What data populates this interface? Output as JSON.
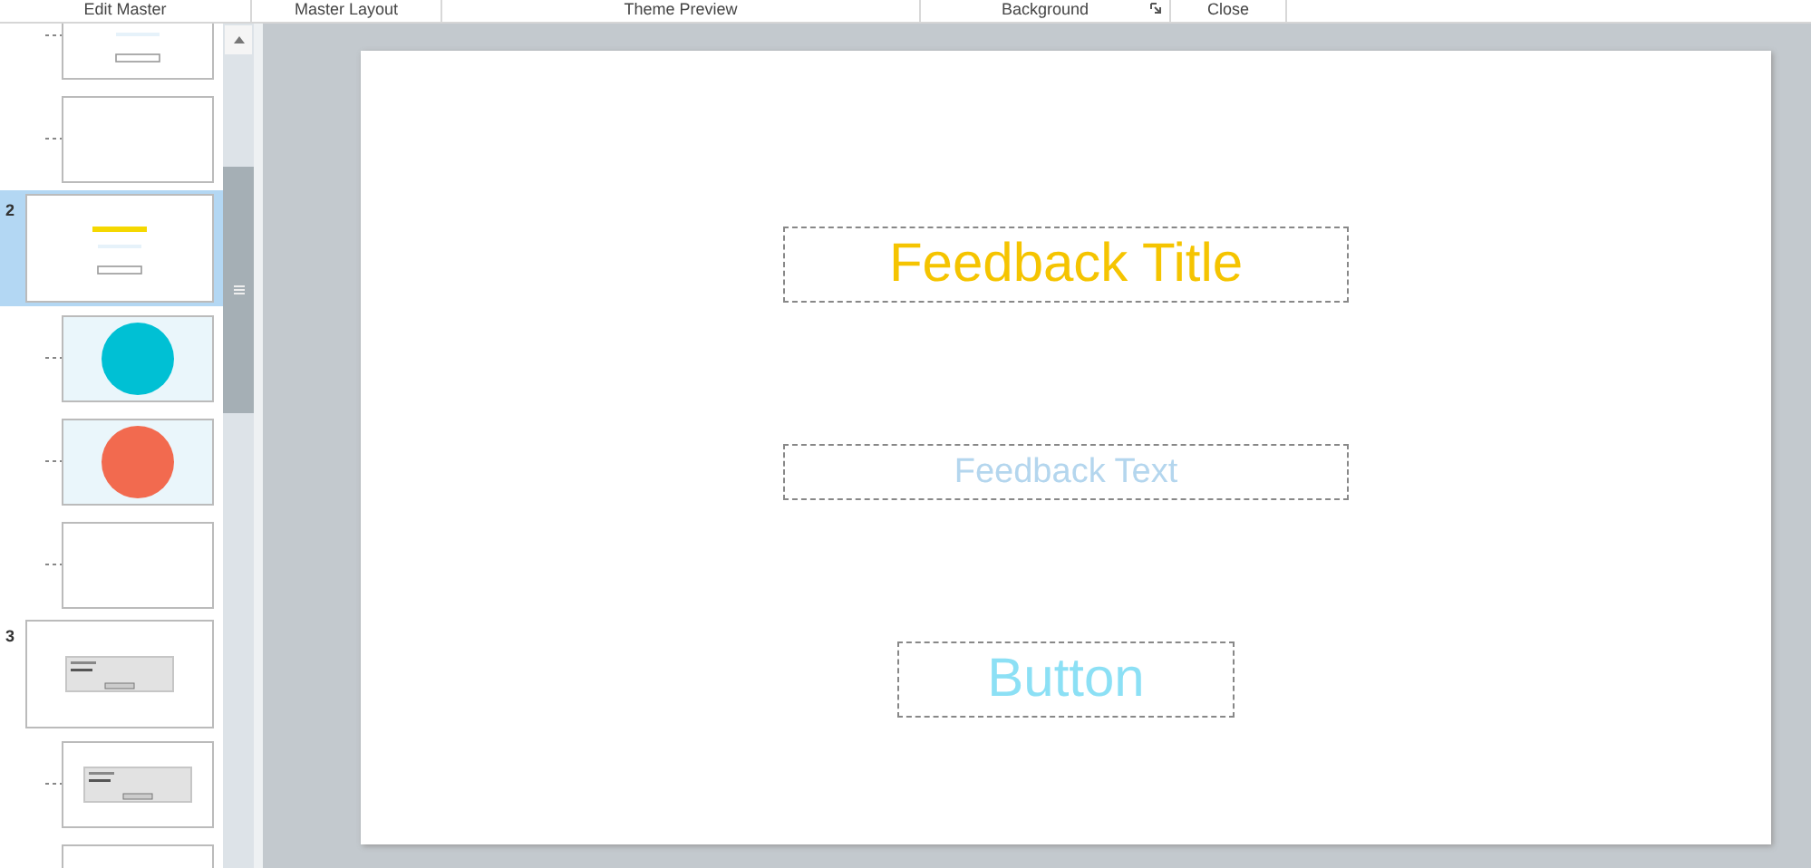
{
  "ribbon": [
    {
      "label": "Edit Master"
    },
    {
      "label": "Master Layout"
    },
    {
      "label": "Theme Preview"
    },
    {
      "label": "Background",
      "launcher": true
    },
    {
      "label": "Close"
    }
  ],
  "masters": [
    {
      "layouts": [
        {
          "kind": "feedback"
        },
        {
          "kind": "blank"
        }
      ]
    },
    {
      "number": "2",
      "selected": true,
      "kind": "feedback",
      "layouts": [
        {
          "kind": "circle",
          "color": "#00c0d4"
        },
        {
          "kind": "circle",
          "color": "#f26a4f"
        },
        {
          "kind": "blank"
        }
      ]
    },
    {
      "number": "3",
      "selected": false,
      "kind": "dialog",
      "layouts": [
        {
          "kind": "dialog"
        },
        {
          "kind": "blank"
        }
      ]
    }
  ],
  "slide": {
    "title": "Feedback Title",
    "text": "Feedback Text",
    "button": "Button"
  }
}
